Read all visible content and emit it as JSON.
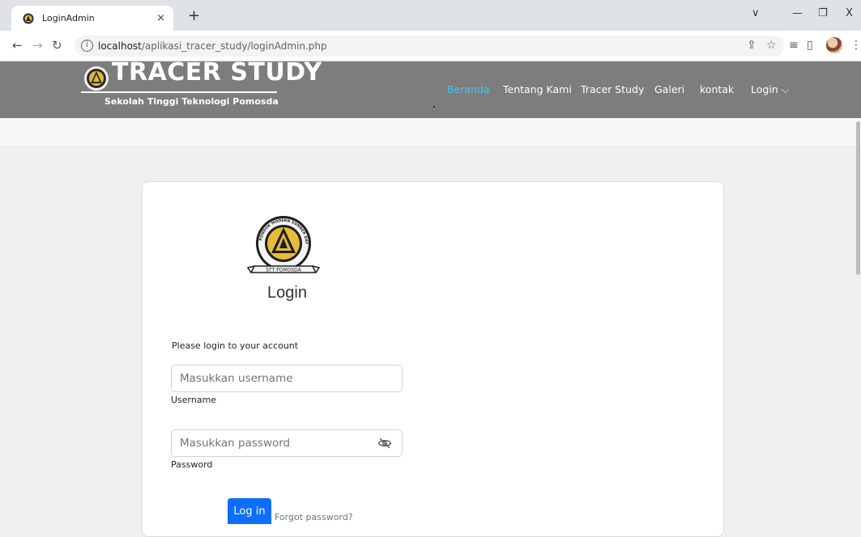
{
  "browser": {
    "tab_title": "LoginAdmin",
    "tab_close": "×",
    "new_tab": "+",
    "url_host": "localhost",
    "url_path": "/aplikasi_tracer_study/loginAdmin.php",
    "win_minimize": "—",
    "win_restore": "❐",
    "win_close": "X",
    "tab_search": "∨"
  },
  "header": {
    "brand_title": "TRACER STUDY",
    "brand_subtitle": "Sekolah Tinggi Teknologi Pomosda",
    "menu": [
      "Beranda",
      "Tentang Kami",
      "Tracer Study",
      "Galeri",
      "kontak",
      "Login ⌵"
    ],
    "colors": {
      "header_bg": "#7d7d7d",
      "active_link": "#4cc3e6"
    }
  },
  "seal": {
    "top_text": "PONDOK MODERN SUMBER DAYA AT-TAQWA",
    "bottom_text": "STT POMOSDA"
  },
  "login": {
    "heading": "Login",
    "prompt": "Please login to your account",
    "username_placeholder": "Masukkan username",
    "username_label": "Username",
    "password_placeholder": "Masukkan password",
    "password_label": "Password",
    "submit_label": "Log in",
    "forgot_label": "Forgot password?",
    "colors": {
      "button": "#0d6efd"
    }
  }
}
